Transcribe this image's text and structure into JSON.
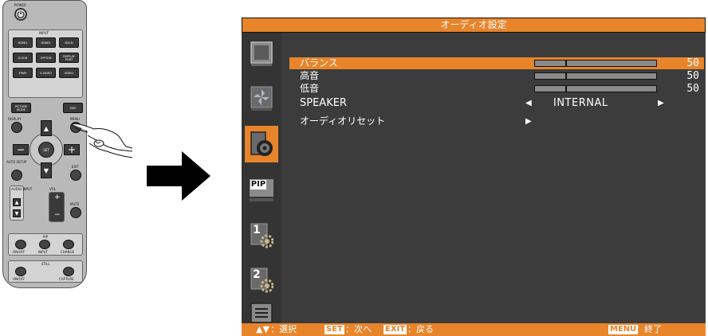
{
  "remote": {
    "power_label": "POWER",
    "input_label": "INPUT",
    "input_keys": [
      "HDMI1",
      "HDMI2",
      "DVI-D",
      "D-SUB",
      "OPTION",
      "DISPLAY PORT",
      "YPbPr",
      "S-VIDEO",
      "VIDEO"
    ],
    "picture_mode_label": "PICTURE MODE",
    "size_label": "SIZE",
    "display_label": "DISPLAY",
    "menu_label": "MENU",
    "set_label": "SET",
    "minus": "−",
    "plus": "+",
    "up": "▲",
    "down": "▼",
    "auto_setup_label": "AUTO SETUP",
    "exit_label": "EXIT",
    "audio_input_label": "AUDIO INPUT",
    "vol_label": "VOL",
    "mute_label": "MUTE",
    "pip_label": "PIP",
    "pip_keys": [
      "ON/OFF",
      "INPUT",
      "CHANGE"
    ],
    "still_label": "STILL",
    "still_keys": [
      "ON/OFF",
      "CAPTURE"
    ]
  },
  "osd": {
    "title": "オーディオ設定",
    "sidebar_icons": [
      "monitor-icon",
      "fan-icon",
      "speaker-icon",
      "pip-icon",
      "setting-1-icon",
      "setting-2-icon",
      "menu-list-icon"
    ],
    "pip_text": "PIP",
    "digit_1": "1",
    "digit_2": "2",
    "rows": [
      {
        "label": "バランス",
        "value": "50",
        "level": 0.25
      },
      {
        "label": "高音",
        "value": "50",
        "level": 0.25
      },
      {
        "label": "低音",
        "value": "50",
        "level": 0.25
      }
    ],
    "speaker": {
      "label": "SPEAKER",
      "left_arrow": "◀",
      "value": "INTERNAL",
      "right_arrow": "▶"
    },
    "reset": {
      "label": "オーディオリセット",
      "arrow": "▶"
    },
    "footer": {
      "nav_arrows": "▲▼",
      "nav_text": "：選択",
      "set_key": "SET",
      "set_text": "：次へ",
      "exit_key": "EXIT",
      "exit_text": "：戻る",
      "menu_key": "MENU",
      "menu_text": "：終了"
    },
    "colors": {
      "accent": "#e8842a",
      "background": "#3c3c3c",
      "text": "#ffffff"
    }
  }
}
